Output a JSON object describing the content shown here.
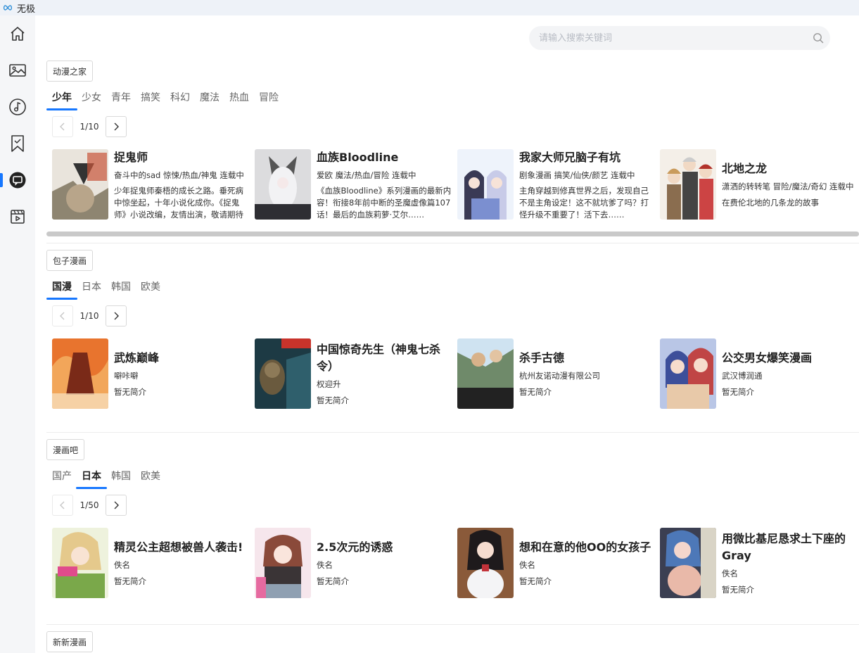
{
  "app": {
    "title": "无极"
  },
  "sidebar": {
    "items": [
      {
        "icon": "home-icon"
      },
      {
        "icon": "image-icon"
      },
      {
        "icon": "music-icon"
      },
      {
        "icon": "bookmark-icon"
      },
      {
        "icon": "comic-icon"
      },
      {
        "icon": "video-icon"
      }
    ],
    "active_index": 4
  },
  "search": {
    "placeholder": "请输入搜索关键词",
    "value": ""
  },
  "sections": [
    {
      "source": "动漫之家",
      "tabs": [
        "少年",
        "少女",
        "青年",
        "搞笑",
        "科幻",
        "魔法",
        "热血",
        "冒险"
      ],
      "active_tab": 0,
      "page": "1/10",
      "cards": [
        {
          "title": "捉鬼师",
          "meta": "奋斗中的sad 惊悚/热血/神鬼 连载中",
          "desc": "少年捉鬼师秦梧的成长之路。垂死病中惊坐起，十年小说化成你。《捉鬼师》小说改编，友情出演，敬请期待"
        },
        {
          "title": "血族Bloodline",
          "meta": "爱欧 魔法/热血/冒险 连载中",
          "desc": "《血族Bloodline》系列漫画的最新内容！衔接8年前中断的圣魔虚像篇107话！最后的血族莉萝·艾尔……"
        },
        {
          "title": "我家大师兄脑子有坑",
          "meta": "剧象漫画 搞笑/仙侠/颜艺 连载中",
          "desc": "主角穿越到修真世界之后，发现自己不是主角设定！这不就坑爹了吗？打怪升级不重要了！活下去……"
        },
        {
          "title": "北地之龙",
          "meta": "潇洒的转转笔 冒险/魔法/奇幻 连载中",
          "desc": "在费伦北地的几条龙的故事"
        }
      ]
    },
    {
      "source": "包子漫画",
      "tabs": [
        "国漫",
        "日本",
        "韩国",
        "欧美"
      ],
      "active_tab": 0,
      "page": "1/10",
      "cards": [
        {
          "title": "武炼巅峰",
          "meta": "噼咔噼",
          "desc": "暂无简介"
        },
        {
          "title": "中国惊奇先生（神鬼七杀令）",
          "meta": "权迎升",
          "desc": "暂无简介"
        },
        {
          "title": "杀手古德",
          "meta": "杭州友诺动漫有限公司",
          "desc": "暂无简介"
        },
        {
          "title": "公交男女爆笑漫画",
          "meta": "武汉博润通",
          "desc": "暂无简介"
        }
      ]
    },
    {
      "source": "漫画吧",
      "tabs": [
        "国产",
        "日本",
        "韩国",
        "欧美"
      ],
      "active_tab": 1,
      "page": "1/50",
      "cards": [
        {
          "title": "精灵公主超想被兽人袭击!",
          "meta": "佚名",
          "desc": "暂无简介"
        },
        {
          "title": "2.5次元的诱惑",
          "meta": "佚名",
          "desc": "暂无简介"
        },
        {
          "title": "想和在意的他OO的女孩子",
          "meta": "佚名",
          "desc": "暂无简介"
        },
        {
          "title": "用微比基尼恳求土下座的Gray",
          "meta": "佚名",
          "desc": "暂无简介"
        }
      ]
    },
    {
      "source": "新新漫画"
    }
  ],
  "colors": {
    "accent": "#1677ff",
    "sidebar_bg": "#f5f6f8",
    "titlebar_bg": "#eef2f8"
  }
}
